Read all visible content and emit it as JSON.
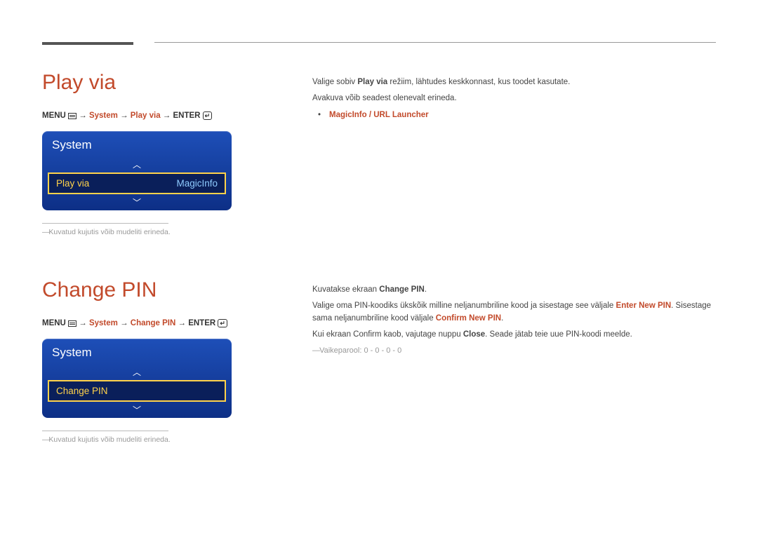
{
  "section1": {
    "heading": "Play via",
    "breadcrumb": {
      "p1": "MENU ",
      "p2": " → ",
      "p3": "System",
      "p4": " → ",
      "p5": "Play via",
      "p6": " → ",
      "p7": "ENTER "
    },
    "card": {
      "title": "System",
      "row_key": "Play via",
      "row_val": "MagicInfo"
    },
    "footnote": "Kuvatud kujutis võib mudeliti erineda.",
    "body": {
      "line1a": "Valige sobiv ",
      "line1b": "Play via",
      "line1c": " režiim, lähtudes keskkonnast, kus toodet kasutate.",
      "line2": "Avakuva võib seadest olenevalt erineda.",
      "bullet1": "MagicInfo / URL Launcher"
    }
  },
  "section2": {
    "heading": "Change PIN",
    "breadcrumb": {
      "p1": "MENU ",
      "p2": " → ",
      "p3": "System",
      "p4": " → ",
      "p5": "Change PIN",
      "p6": " → ",
      "p7": "ENTER "
    },
    "card": {
      "title": "System",
      "row_key": "Change PIN"
    },
    "footnote": "Kuvatud kujutis võib mudeliti erineda.",
    "body": {
      "line1a": "Kuvatakse ekraan ",
      "line1b": "Change PIN",
      "line1c": ".",
      "line2a": "Valige oma PIN-koodiks ükskõik milline neljanumbriline kood ja sisestage see väljale ",
      "line2b": "Enter New PIN",
      "line2c": ". Sisestage sama neljanumbriline kood väljale ",
      "line2d": "Confirm New PIN",
      "line2e": ".",
      "line3a": "Kui ekraan Confirm kaob, vajutage nuppu ",
      "line3b": "Close",
      "line3c": ". Seade jätab teie uue PIN-koodi meelde.",
      "note": "Vaikeparool: 0 - 0 - 0 - 0"
    }
  }
}
